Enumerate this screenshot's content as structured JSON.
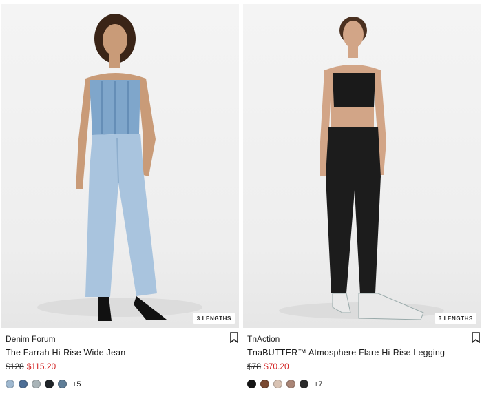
{
  "products": [
    {
      "brand": "Denim Forum",
      "name": "The Farrah Hi-Rise Wide Jean",
      "original_price": "$128",
      "sale_price": "$115.20",
      "badge": "3 LENGTHS",
      "more_colors": "+5",
      "swatches": [
        "#9fb8cf",
        "#4d6e96",
        "#a9b4b8",
        "#1f2428",
        "#5e7d97"
      ],
      "image_icon": "model-wide-jean-photo"
    },
    {
      "brand": "TnAction",
      "name": "TnaBUTTER™ Atmosphere Flare Hi-Rise Legging",
      "original_price": "$78",
      "sale_price": "$70.20",
      "badge": "3 LENGTHS",
      "more_colors": "+7",
      "swatches": [
        "#141414",
        "#7a4a32",
        "#d9c3b4",
        "#a98576",
        "#2a2a2a"
      ],
      "image_icon": "model-flare-legging-photo"
    }
  ],
  "colors": {
    "sale": "#d32424",
    "text": "#1a1a1a"
  }
}
